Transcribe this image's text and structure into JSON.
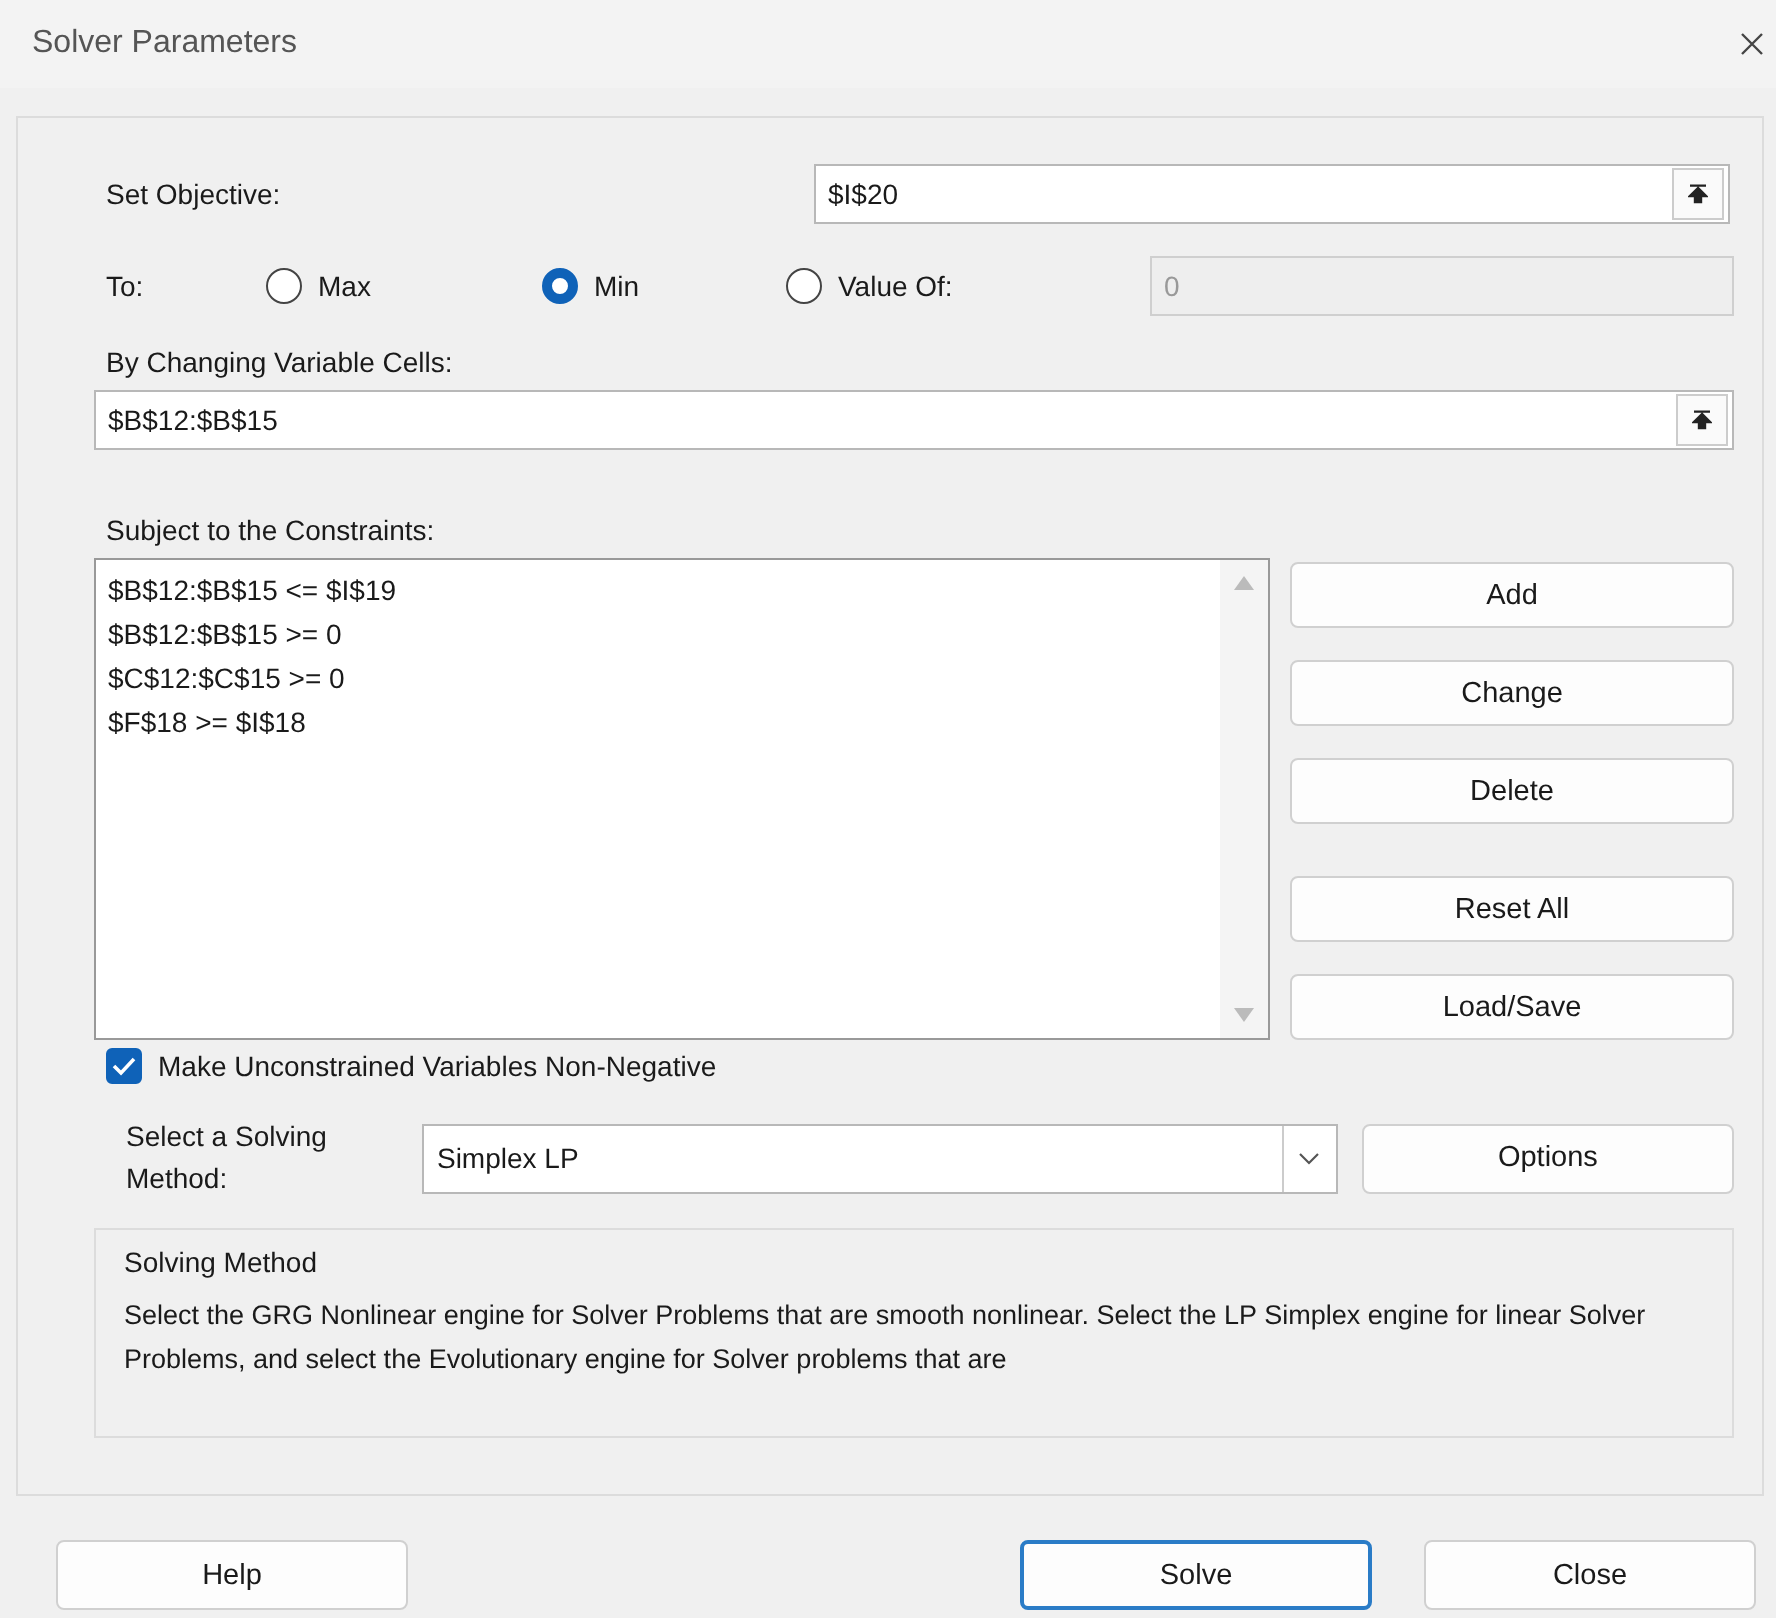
{
  "window": {
    "title": "Solver Parameters"
  },
  "objective": {
    "label": "Set Objective:",
    "value": "$I$20"
  },
  "to": {
    "label": "To:",
    "options": [
      {
        "label": "Max",
        "selected": false
      },
      {
        "label": "Min",
        "selected": true
      },
      {
        "label": "Value Of:",
        "selected": false
      }
    ],
    "value_field": {
      "value": "0",
      "disabled": true
    }
  },
  "variables": {
    "label": "By Changing Variable Cells:",
    "value": "$B$12:$B$15"
  },
  "constraints": {
    "label": "Subject to the Constraints:",
    "items": [
      "$B$12:$B$15 <= $I$19",
      "$B$12:$B$15 >= 0",
      "$C$12:$C$15 >= 0",
      "$F$18 >= $I$18"
    ],
    "buttons": [
      {
        "label": "Add"
      },
      {
        "label": "Change"
      },
      {
        "label": "Delete"
      },
      {
        "label": "Reset All"
      },
      {
        "label": "Load/Save"
      }
    ]
  },
  "nonnegative": {
    "label": "Make Unconstrained Variables Non-Negative",
    "checked": true
  },
  "method": {
    "label": "Select a Solving Method:",
    "value": "Simplex LP",
    "options_button": {
      "label": "Options"
    }
  },
  "description": {
    "title": "Solving Method",
    "text": "Select the GRG Nonlinear engine for Solver Problems that are smooth nonlinear. Select the LP Simplex engine for linear Solver Problems, and select the Evolutionary engine for Solver problems that are"
  },
  "footer": [
    {
      "label": "Help",
      "focused": false
    },
    {
      "label": "Solve",
      "focused": true
    },
    {
      "label": "Close",
      "focused": false
    }
  ]
}
